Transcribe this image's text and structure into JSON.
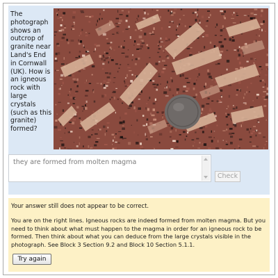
{
  "question": {
    "text": "The photograph shows an outcrop of granite near Land's End in Cornwall (UK). How is an igneous rock with large crystals (such as this granite) formed?",
    "photo_name": "granite-outcrop-photo"
  },
  "answer": {
    "value": "they are formed from molten magma"
  },
  "check_button": {
    "label": "Check"
  },
  "feedback": {
    "status": "Your answer still does not appear to be correct.",
    "body": "You are on the right lines. Igneous rocks are indeed formed from molten magma. But you need to think about what must happen to the magma in order for an igneous rock to be formed. Then think about what you can deduce from the large crystals visible in the photograph. See Block 3 Section 9.2 and Block 10 Section 5.1.1.",
    "try_again_label": "Try again"
  },
  "colors": {
    "question_panel_bg": "#dce8f5",
    "feedback_panel_bg": "#fdf1c6",
    "rock_base": "#8a4a3e",
    "coin": "#6f6a68"
  }
}
